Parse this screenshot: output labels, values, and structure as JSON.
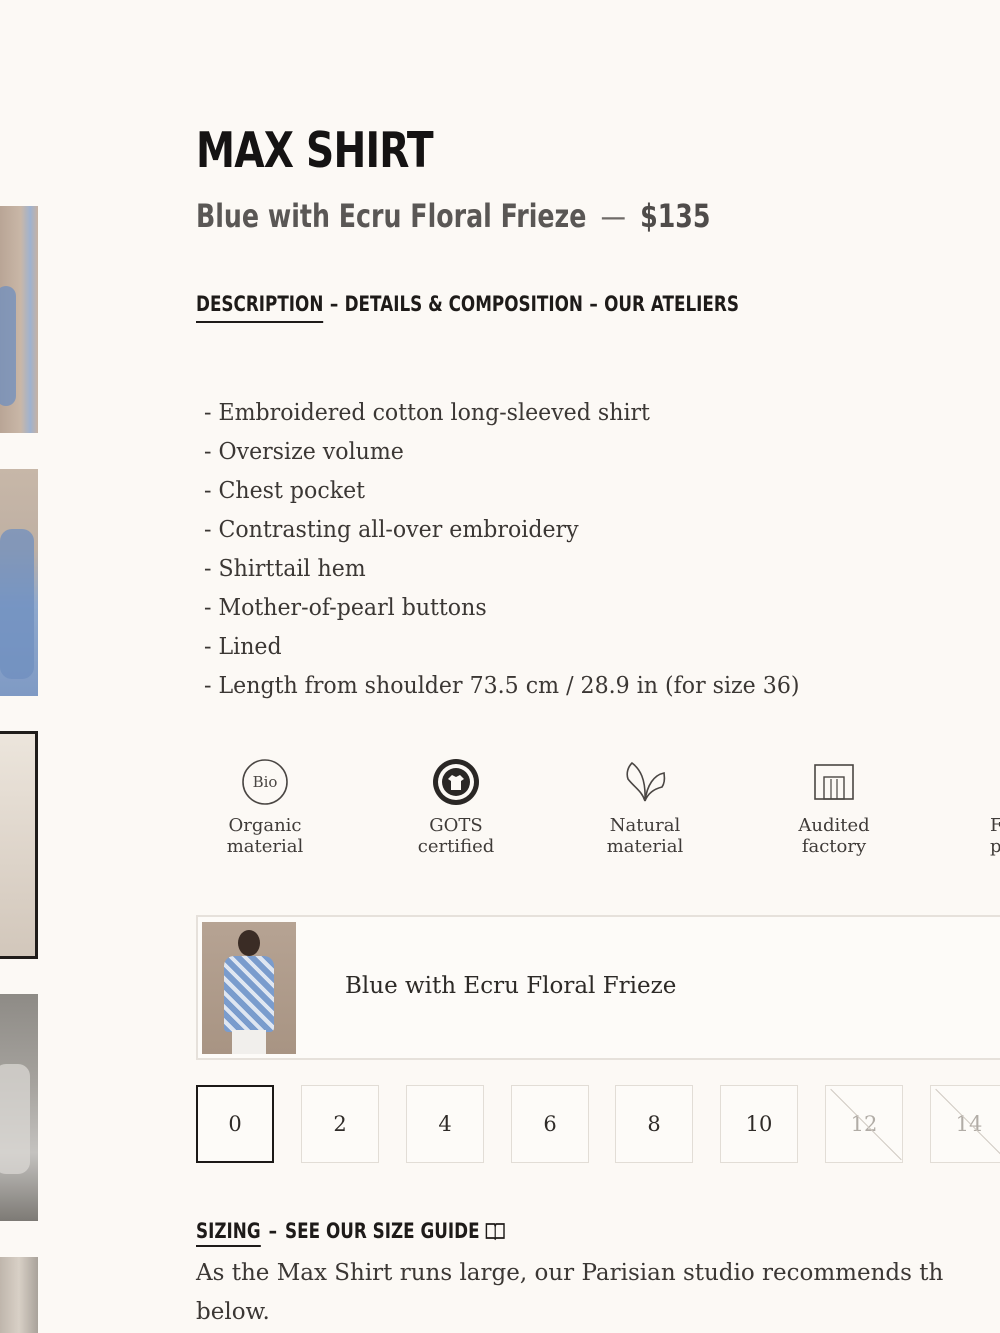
{
  "product": {
    "title": "MAX SHIRT",
    "color": "Blue with Ecru Floral Frieze",
    "separator": "—",
    "price": "$135"
  },
  "tabs": [
    {
      "label": "DESCRIPTION",
      "active": true
    },
    {
      "label": "DETAILS & COMPOSITION",
      "active": false
    },
    {
      "label": "OUR ATELIERS",
      "active": false
    }
  ],
  "tab_separator": "–",
  "description": [
    "Embroidered cotton long-sleeved shirt",
    "Oversize volume",
    "Chest pocket",
    "Contrasting all-over embroidery",
    "Shirttail hem",
    "Mother-of-pearl buttons",
    "Lined",
    "Length from shoulder 73.5 cm / 28.9 in (for size 36)"
  ],
  "badges": [
    {
      "icon": "bio-icon",
      "icon_text": "Bio",
      "line1": "Organic",
      "line2": "material"
    },
    {
      "icon": "gots-icon",
      "line1": "GOTS",
      "line2": "certified"
    },
    {
      "icon": "leaf-icon",
      "line1": "Natural",
      "line2": "material"
    },
    {
      "icon": "factory-icon",
      "line1": "Audited",
      "line2": "factory"
    },
    {
      "icon": "partial-badge-icon",
      "line1": "F",
      "line2": "p"
    }
  ],
  "color_option": {
    "name": "Blue with Ecru Floral Frieze"
  },
  "sizes": [
    {
      "label": "0",
      "state": "selected"
    },
    {
      "label": "2",
      "state": "available"
    },
    {
      "label": "4",
      "state": "available"
    },
    {
      "label": "6",
      "state": "available"
    },
    {
      "label": "8",
      "state": "available"
    },
    {
      "label": "10",
      "state": "available"
    },
    {
      "label": "12",
      "state": "unavailable"
    },
    {
      "label": "14",
      "state": "unavailable"
    }
  ],
  "sizing": {
    "label": "SIZING",
    "separator": "–",
    "guide_label": "SEE OUR SIZE GUIDE",
    "text_line1": "As the Max Shirt runs large, our Parisian studio recommends th",
    "text_line2": "below."
  },
  "colors": {
    "background": "#fcf9f5",
    "text_dark": "#151313",
    "text_body": "#3b3734",
    "border": "#e2ddd6",
    "unavailable": "#b1aca6"
  }
}
